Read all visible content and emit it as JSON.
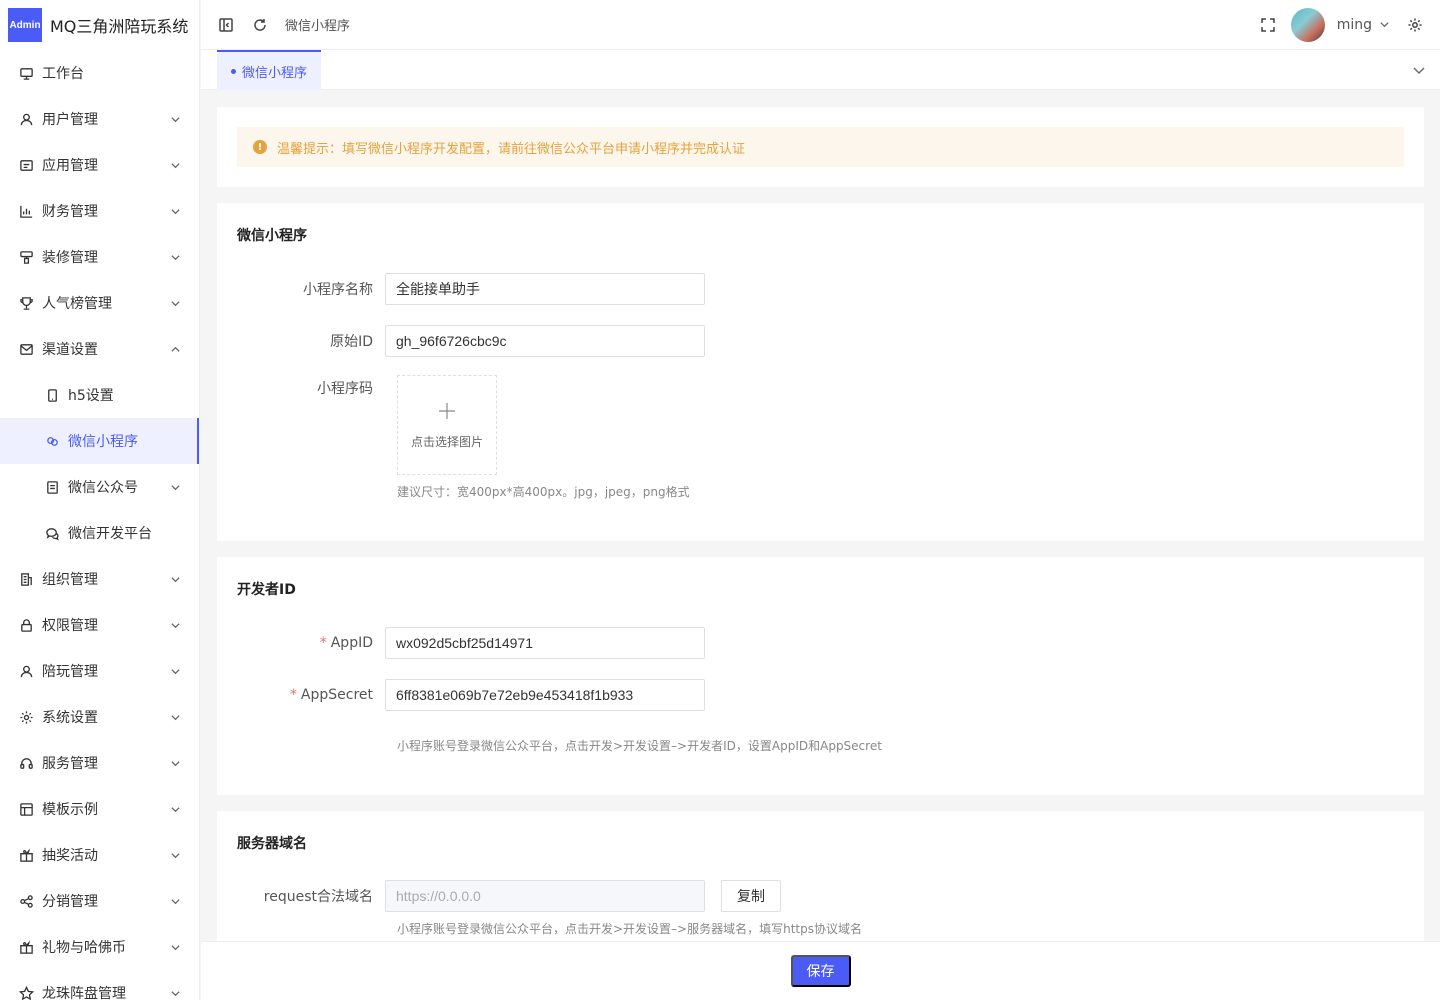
{
  "brand": {
    "logo_text": "Admin",
    "title": "MQ三角洲陪玩系统"
  },
  "sidebar": {
    "items": [
      {
        "label": "工作台"
      },
      {
        "label": "用户管理"
      },
      {
        "label": "应用管理"
      },
      {
        "label": "财务管理"
      },
      {
        "label": "装修管理"
      },
      {
        "label": "人气榜管理"
      },
      {
        "label": "渠道设置"
      },
      {
        "label": "h5设置"
      },
      {
        "label": "微信小程序"
      },
      {
        "label": "微信公众号"
      },
      {
        "label": "微信开发平台"
      },
      {
        "label": "组织管理"
      },
      {
        "label": "权限管理"
      },
      {
        "label": "陪玩管理"
      },
      {
        "label": "系统设置"
      },
      {
        "label": "服务管理"
      },
      {
        "label": "模板示例"
      },
      {
        "label": "抽奖活动"
      },
      {
        "label": "分销管理"
      },
      {
        "label": "礼物与哈佛币"
      },
      {
        "label": "龙珠阵盘管理"
      }
    ]
  },
  "header": {
    "breadcrumb": "微信小程序",
    "user_name": "ming"
  },
  "tabs": [
    {
      "label": "微信小程序"
    }
  ],
  "notice": {
    "text": "温馨提示：填写微信小程序开发配置，请前往微信公众平台申请小程序并完成认证"
  },
  "miniprogram": {
    "title": "微信小程序",
    "name_label": "小程序名称",
    "name_value": "全能接单助手",
    "origin_label": "原始ID",
    "origin_value": "gh_96f6726cbc9c",
    "code_label": "小程序码",
    "upload_text": "点击选择图片",
    "upload_hint": "建议尺寸：宽400px*高400px。jpg，jpeg，png格式"
  },
  "developer": {
    "title": "开发者ID",
    "appid_label": "AppID",
    "appid_value": "wx092d5cbf25d14971",
    "secret_label": "AppSecret",
    "secret_value": "6ff8381e069b7e72eb9e453418f1b933",
    "hint": "小程序账号登录微信公众平台，点击开发>开发设置–>开发者ID，设置AppID和AppSecret"
  },
  "server": {
    "title": "服务器域名",
    "request_label": "request合法域名",
    "request_value": "https://0.0.0.0",
    "copy_label": "复制",
    "hint": "小程序账号登录微信公众平台，点击开发>开发设置–>服务器域名，填写https协议域名"
  },
  "footer": {
    "save_label": "保存"
  },
  "colors": {
    "primary": "#4a5cf5",
    "warning": "#e6a23c",
    "warning_bg": "#fdf6ec",
    "required": "#f56c6c"
  }
}
